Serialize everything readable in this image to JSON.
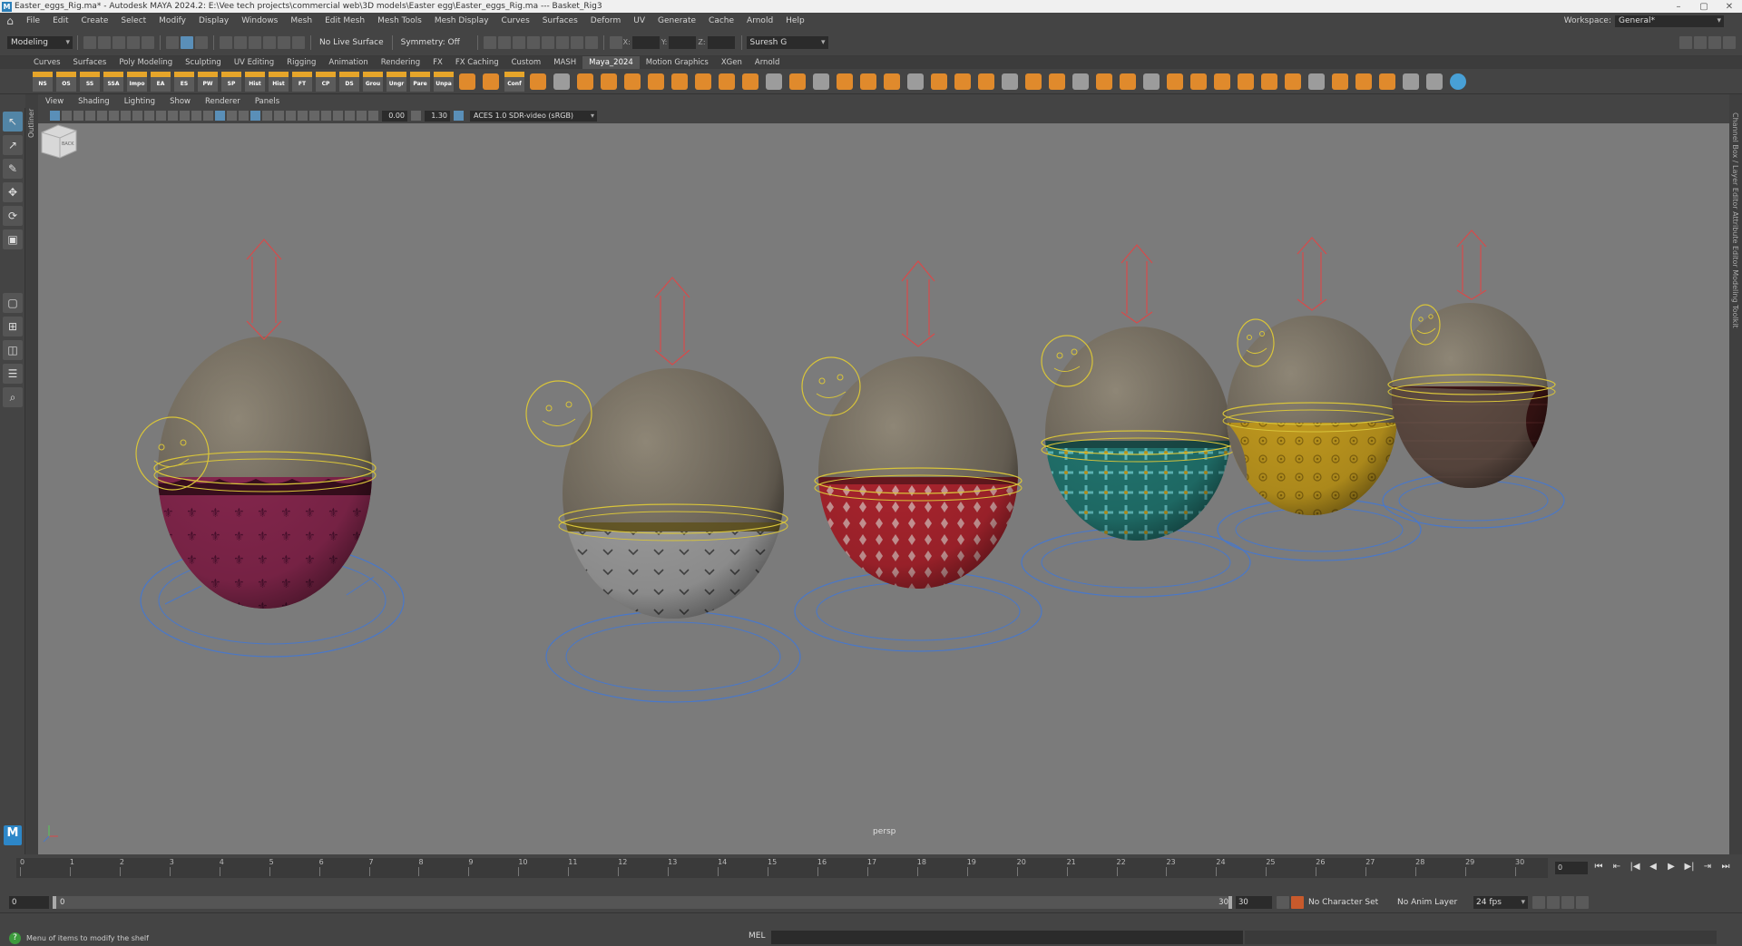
{
  "window": {
    "title": "Easter_eggs_Rig.ma* - Autodesk MAYA 2024.2: E:\\Vee tech projects\\commercial web\\3D models\\Easter egg\\Easter_eggs_Rig.ma  ---  Basket_Rig3",
    "app_icon": "M"
  },
  "menu": {
    "items": [
      "File",
      "Edit",
      "Create",
      "Select",
      "Modify",
      "Display",
      "Windows",
      "Mesh",
      "Edit Mesh",
      "Mesh Tools",
      "Mesh Display",
      "Curves",
      "Surfaces",
      "Deform",
      "UV",
      "Generate",
      "Cache",
      "Arnold",
      "Help"
    ],
    "workspace_label": "Workspace:",
    "workspace_value": "General*"
  },
  "statusline": {
    "mode": "Modeling",
    "live_surface": "No Live Surface",
    "symmetry": "Symmetry: Off",
    "x_label": "X:",
    "y_label": "Y:",
    "z_label": "Z:",
    "user": "Suresh G"
  },
  "shelf": {
    "tabs": [
      "Curves",
      "Surfaces",
      "Poly Modeling",
      "Sculpting",
      "UV Editing",
      "Rigging",
      "Animation",
      "Rendering",
      "FX",
      "FX Caching",
      "Custom",
      "MASH",
      "Maya_2024",
      "Motion Graphics",
      "XGen",
      "Arnold"
    ],
    "active_tab": "Maya_2024",
    "buttons": [
      "NS",
      "OS",
      "SS",
      "SSA",
      "Impo",
      "EA",
      "ES",
      "PW",
      "SP",
      "Hist",
      "Hist",
      "FT",
      "CP",
      "DS",
      "Grou",
      "Ungr",
      "Pare",
      "Unpa",
      "Conf"
    ]
  },
  "panel": {
    "menus": [
      "View",
      "Shading",
      "Lighting",
      "Show",
      "Renderer",
      "Panels"
    ],
    "exposure": "0.00",
    "gamma": "1.30",
    "color_space": "ACES 1.0 SDR-video (sRGB)",
    "camera": "persp",
    "viewcube_label": "BACK"
  },
  "side_labels": {
    "outliner": "Outliner",
    "right": "Channel Box / Layer Editor     Attribute Editor     Modeling Toolkit"
  },
  "timeline": {
    "ticks": [
      "0",
      "1",
      "2",
      "3",
      "4",
      "5",
      "6",
      "7",
      "8",
      "9",
      "10",
      "11",
      "12",
      "13",
      "14",
      "15",
      "16",
      "17",
      "18",
      "19",
      "20",
      "21",
      "22",
      "23",
      "24",
      "25",
      "26",
      "27",
      "28",
      "29",
      "30"
    ],
    "current_frame": "0",
    "current_marker": "0"
  },
  "range": {
    "start": "0",
    "inner_start": "0",
    "inner_end": "30",
    "end": "30",
    "end2": "30",
    "character_set": "No Character Set",
    "anim_layer": "No Anim Layer",
    "fps": "24 fps"
  },
  "bottom": {
    "help_text": "Menu of items to modify the shelf",
    "mel_label": "MEL"
  },
  "eggs": [
    {
      "name": "egg-1-pink-fleur",
      "band": "#8a2850"
    },
    {
      "name": "egg-2-grey-chevron",
      "band": "#9a9a9a"
    },
    {
      "name": "egg-3-red-diamond",
      "band": "#b22630"
    },
    {
      "name": "egg-4-teal-cross",
      "band": "#1f7a7a"
    },
    {
      "name": "egg-5-yellow-flower",
      "band": "#c9a020"
    },
    {
      "name": "egg-6-dark-red",
      "band": "#3a1414"
    }
  ],
  "colors": {
    "viewport_bg": "#7b7b7b",
    "egg_shell": "#7d7466",
    "controller_yellow": "#d8c43a",
    "controller_red": "#d84a4a",
    "controller_blue": "#4a78c8"
  }
}
